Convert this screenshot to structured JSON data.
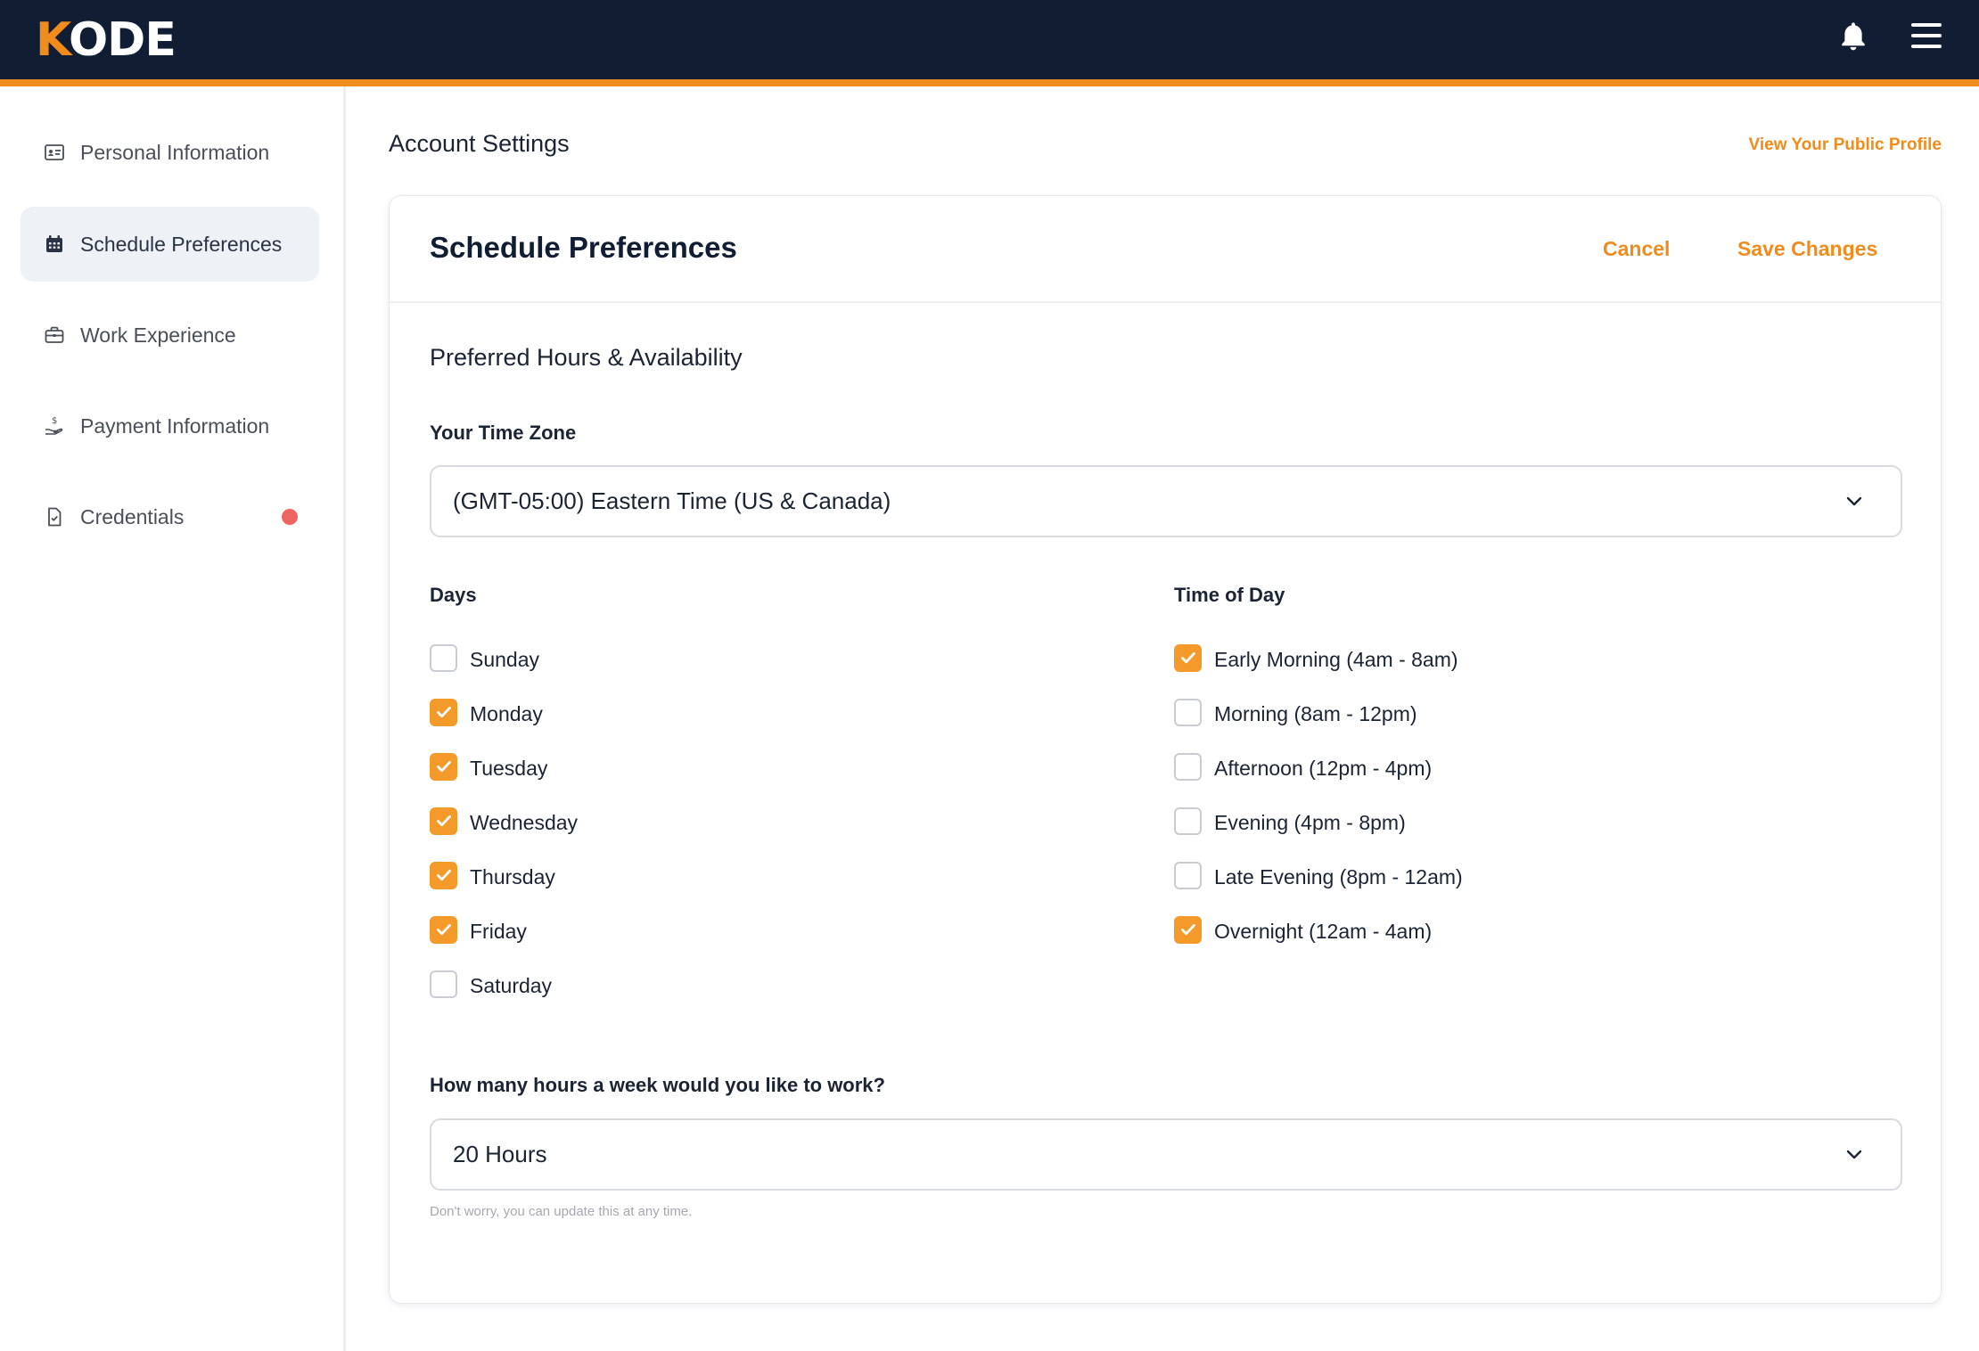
{
  "app": {
    "logo_first": "K",
    "logo_rest": "ODE"
  },
  "colors": {
    "accent": "#f08c1e",
    "nav_bg": "#111d33",
    "checkbox_on": "#f39a2b",
    "alert_dot": "#ef6461"
  },
  "sidebar": {
    "items": [
      {
        "label": "Personal Information",
        "icon": "id-card-icon"
      },
      {
        "label": "Schedule Preferences",
        "icon": "calendar-icon",
        "active": true
      },
      {
        "label": "Work Experience",
        "icon": "briefcase-icon"
      },
      {
        "label": "Payment Information",
        "icon": "hand-coin-icon"
      },
      {
        "label": "Credentials",
        "icon": "document-check-icon",
        "alert": true
      }
    ]
  },
  "header": {
    "title": "Account Settings",
    "public_profile_link": "View Your Public Profile"
  },
  "card": {
    "title": "Schedule Preferences",
    "cancel_label": "Cancel",
    "save_label": "Save Changes",
    "section_title": "Preferred Hours & Availability",
    "timezone_label": "Your Time Zone",
    "timezone_value": "(GMT-05:00) Eastern Time (US & Canada)",
    "days_label": "Days",
    "days": [
      {
        "label": "Sunday",
        "checked": false
      },
      {
        "label": "Monday",
        "checked": true
      },
      {
        "label": "Tuesday",
        "checked": true
      },
      {
        "label": "Wednesday",
        "checked": true
      },
      {
        "label": "Thursday",
        "checked": true
      },
      {
        "label": "Friday",
        "checked": true
      },
      {
        "label": "Saturday",
        "checked": false
      }
    ],
    "time_label": "Time of Day",
    "times": [
      {
        "label": "Early Morning (4am - 8am)",
        "checked": true
      },
      {
        "label": "Morning (8am - 12pm)",
        "checked": false
      },
      {
        "label": "Afternoon (12pm - 4pm)",
        "checked": false
      },
      {
        "label": "Evening (4pm - 8pm)",
        "checked": false
      },
      {
        "label": "Late Evening (8pm - 12am)",
        "checked": false
      },
      {
        "label": "Overnight (12am - 4am)",
        "checked": true
      }
    ],
    "hours_label": "How many hours a week would you like to work?",
    "hours_value": "20 Hours",
    "hours_hint": "Don't worry, you can update this at any time."
  }
}
